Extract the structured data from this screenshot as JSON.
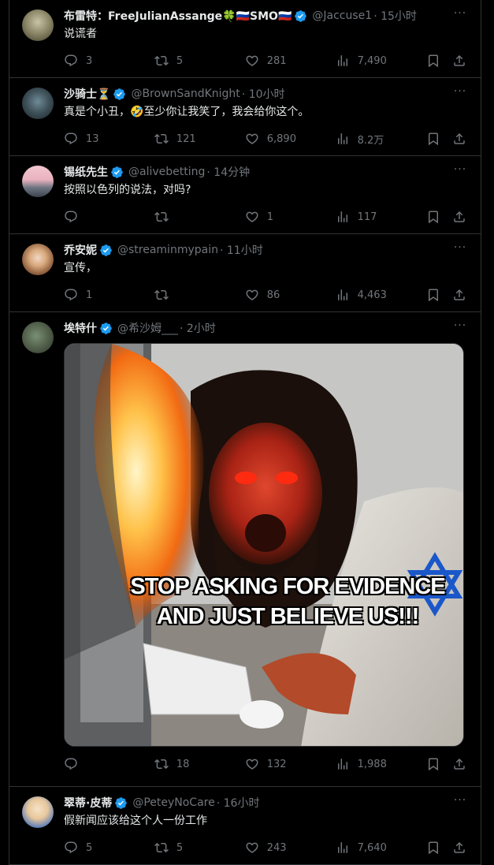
{
  "tweets": [
    {
      "name": "布雷特：FreeJulianAssange🍀🇷🇺SMO🇷🇺",
      "handle": "@Jaccuse1",
      "time": "· 15小时",
      "verified": true,
      "text": "说谎者",
      "reply": "3",
      "retweet": "5",
      "like": "281",
      "views": "7,490"
    },
    {
      "name": "沙骑士⏳",
      "handle": "@BrownSandKnight",
      "time": "· 10小时",
      "verified": true,
      "text": "真是个小丑，🤣至少你让我笑了，我会给你这个。",
      "reply": "13",
      "retweet": "121",
      "like": "6,890",
      "views": "8.2万"
    },
    {
      "name": "锡纸先生",
      "handle": "@alivebetting",
      "time": "· 14分钟",
      "verified": true,
      "text": "按照以色列的说法，对吗?",
      "reply": "",
      "retweet": "",
      "like": "1",
      "views": "117"
    },
    {
      "name": "乔安妮",
      "handle": "@streaminmypain",
      "time": "· 11小时",
      "verified": true,
      "text": "宣传，",
      "reply": "1",
      "retweet": "",
      "like": "86",
      "views": "4,463"
    },
    {
      "name": "埃特什",
      "handle": "@希沙姆___",
      "time": "· 2小时",
      "verified": true,
      "text": "",
      "media_caption_line1": "STOP ASKING FOR EVIDENCE",
      "media_caption_line2": "AND JUST BELIEVE US!!!",
      "reply": "",
      "retweet": "18",
      "like": "132",
      "views": "1,988"
    },
    {
      "name": "翠蒂·皮蒂",
      "handle": "@PeteyNoCare",
      "time": "· 16小时",
      "verified": true,
      "text": "假新闻应该给这个人一份工作",
      "reply": "5",
      "retweet": "5",
      "like": "243",
      "views": "7,640"
    }
  ],
  "colors": {
    "background": "#000000",
    "text": "#e7e9ea",
    "muted": "#71767b",
    "border": "#2f3336",
    "verified": "#1d9bf0"
  },
  "icons": [
    "reply-icon",
    "retweet-icon",
    "like-icon",
    "views-icon",
    "bookmark-icon",
    "share-icon",
    "verified-badge-icon",
    "more-icon"
  ]
}
